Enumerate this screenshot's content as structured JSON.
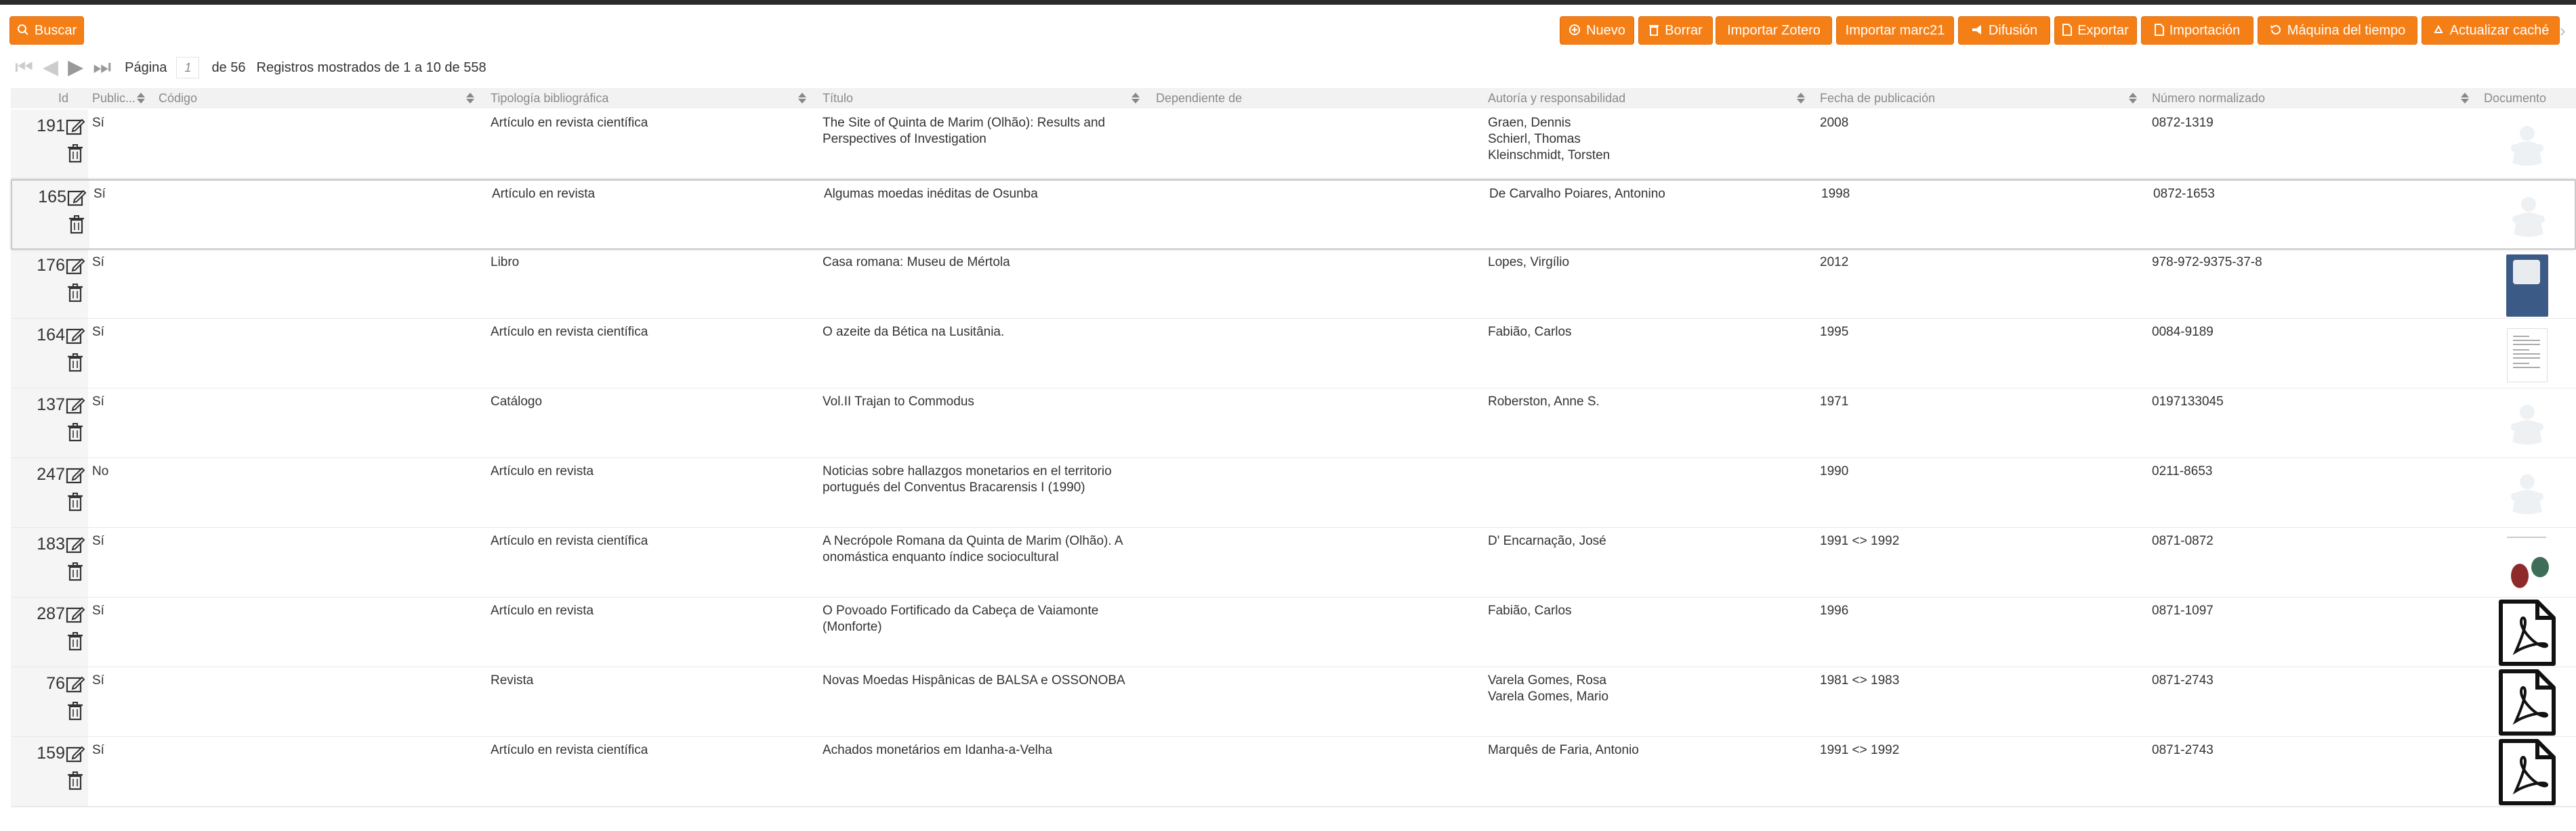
{
  "toolbar": {
    "search_label": "Buscar",
    "buttons": [
      {
        "label": "Nuevo",
        "icon": "plus-circle-icon"
      },
      {
        "label": "Borrar",
        "icon": "trash-icon"
      },
      {
        "label": "Importar Zotero",
        "icon": ""
      },
      {
        "label": "Importar marc21",
        "icon": ""
      },
      {
        "label": "Difusión",
        "icon": "megaphone-icon"
      },
      {
        "label": "Exportar",
        "icon": "file-icon"
      },
      {
        "label": "Importación",
        "icon": "file-icon"
      },
      {
        "label": "Máquina del tiempo",
        "icon": "history-icon"
      },
      {
        "label": "Actualizar caché",
        "icon": "recycle-icon"
      }
    ],
    "accent_color": "#f57f17"
  },
  "pager": {
    "page_label": "Página",
    "page_value": "1",
    "of_text": "de 56",
    "records_text": "Registros mostrados de 1 a 10 de 558"
  },
  "columns": {
    "id": "Id",
    "published": "Public...",
    "code": "Código",
    "typology": "Tipología bibliográfica",
    "title": "Título",
    "depends": "Dependiente de",
    "authors": "Autoría y responsabilidad",
    "date": "Fecha de publicación",
    "number": "Número normalizado",
    "document": "Documento"
  },
  "rows": [
    {
      "id": "191",
      "published": "Sí",
      "code": "",
      "typology": "Artículo en revista científica",
      "title_lines": [
        "The Site of Quinta de Marim (Olhão): Results and",
        "Perspectives of Investigation"
      ],
      "depends": "",
      "authors": [
        "Graen, Dennis",
        "Schierl, Thomas",
        "Kleinschmidt, Torsten"
      ],
      "date": "2008",
      "number": "0872-1319",
      "doc": "placeholder",
      "selected": false
    },
    {
      "id": "165",
      "published": "Sí",
      "code": "",
      "typology": "Artículo en revista",
      "title_lines": [
        "Algumas moedas inéditas de Osunba"
      ],
      "depends": "",
      "authors": [
        "De Carvalho Poiares, Antonino"
      ],
      "date": "1998",
      "number": "0872-1653",
      "doc": "placeholder",
      "selected": true
    },
    {
      "id": "176",
      "published": "Sí",
      "code": "",
      "typology": "Libro",
      "title_lines": [
        "Casa romana: Museu de Mértola"
      ],
      "depends": "",
      "authors": [
        "Lopes, Virgílio"
      ],
      "date": "2012",
      "number": "978-972-9375-37-8",
      "doc": "thumb-blue",
      "selected": false
    },
    {
      "id": "164",
      "published": "Sí",
      "code": "",
      "typology": "Artículo en revista científica",
      "title_lines": [
        "O azeite da Bética na Lusitânia."
      ],
      "depends": "",
      "authors": [
        "Fabião, Carlos"
      ],
      "date": "1995",
      "number": "0084-9189",
      "doc": "thumb-paper",
      "selected": false
    },
    {
      "id": "137",
      "published": "Sí",
      "code": "",
      "typology": "Catálogo",
      "title_lines": [
        "Vol.II Trajan to Commodus"
      ],
      "depends": "",
      "authors": [
        "Roberston, Anne S."
      ],
      "date": "1971",
      "number": "0197133045",
      "doc": "placeholder",
      "selected": false
    },
    {
      "id": "247",
      "published": "No",
      "code": "",
      "typology": "Artículo en revista",
      "title_lines": [
        "Noticias sobre hallazgos monetarios en el territorio",
        "portugués del Conventus Bracarensis I (1990)"
      ],
      "depends": "",
      "authors": [],
      "date": "1990",
      "number": "0211-8653",
      "doc": "placeholder",
      "selected": false
    },
    {
      "id": "183",
      "published": "Sí",
      "code": "",
      "typology": "Artículo en revista científica",
      "title_lines": [
        "A Necrópole Romana da Quinta de Marim (Olhão). A",
        "onomástica enquanto índice sociocultural"
      ],
      "depends": "",
      "authors": [
        "D' Encarnação, José"
      ],
      "date": "1991 <> 1992",
      "number": "0871-0872",
      "doc": "thumb-coins",
      "selected": false
    },
    {
      "id": "287",
      "published": "Sí",
      "code": "",
      "typology": "Artículo en revista",
      "title_lines": [
        "O Povoado Fortificado da Cabeça de Vaiamonte",
        "(Monforte)"
      ],
      "depends": "",
      "authors": [
        "Fabião, Carlos"
      ],
      "date": "1996",
      "number": "0871-1097",
      "doc": "pdf",
      "selected": false
    },
    {
      "id": "76",
      "published": "Sí",
      "code": "",
      "typology": "Revista",
      "title_lines": [
        "Novas Moedas Hispânicas de BALSA e OSSONOBA"
      ],
      "depends": "",
      "authors": [
        "Varela Gomes, Rosa",
        "Varela Gomes, Mario"
      ],
      "date": "1981 <> 1983",
      "number": "0871-2743",
      "doc": "pdf",
      "selected": false
    },
    {
      "id": "159",
      "published": "Sí",
      "code": "",
      "typology": "Artículo en revista científica",
      "title_lines": [
        "Achados monetários em Idanha-a-Velha"
      ],
      "depends": "",
      "authors": [
        "Marquês de Faria, Antonio"
      ],
      "date": "1991 <> 1992",
      "number": "0871-2743",
      "doc": "pdf",
      "selected": false
    }
  ]
}
